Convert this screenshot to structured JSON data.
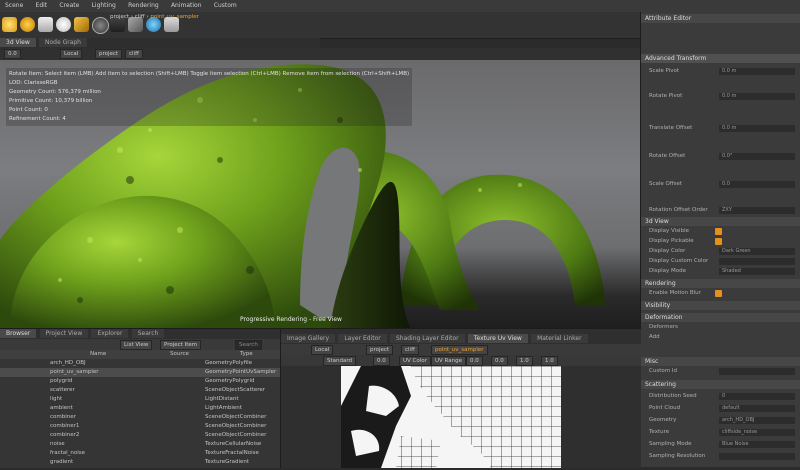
{
  "menubar": {
    "items": [
      "Scene",
      "Edit",
      "Create",
      "Lighting",
      "Rendering",
      "Animation",
      "Custom"
    ]
  },
  "breadcrumb_top": {
    "project": "project",
    "sep": "›",
    "node1": "cliff",
    "node2": "point_uv_sampler"
  },
  "viewport_tabs": {
    "active": "3d View",
    "other": "Node Graph"
  },
  "viewport_toolbar": {
    "space": "Local",
    "project": "project",
    "cliff": "cliff",
    "zoom": "0.0"
  },
  "viewport_info": {
    "hint": "Rotate Item: Select item (LMB)  Add item to selection (Shift+LMB)  Toggle item selection (Ctrl+LMB)  Remove item from selection (Ctrl+Shift+LMB)",
    "lines": [
      "LOD: ClarisseRGB",
      "Geometry Count: 576,379 million",
      "Primitive Count: 10,379 billion",
      "Point Count: 0",
      "Refinement Count: 4"
    ],
    "render_label": "Progressive Rendering - Free View"
  },
  "attribute_editor": {
    "title": "Attribute Editor",
    "section_transform": "Advanced Transform",
    "rows": [
      {
        "label": "Scale Pivot",
        "value": "0.0 m"
      },
      {
        "label": "Rotate Pivot",
        "value": "0.0 m"
      },
      {
        "label": "Translate Offset",
        "value": "0.0 m"
      },
      {
        "label": "Rotate Offset",
        "value": "0.0°"
      },
      {
        "label": "Scale Offset",
        "value": "0.0"
      },
      {
        "label": "Rotation Offset Order",
        "value": "ZXY"
      }
    ],
    "section_3d": "3d View",
    "rows_3d": [
      {
        "label": "Display Visible",
        "value": ""
      },
      {
        "label": "Display Pickable",
        "value": ""
      },
      {
        "label": "Display Color",
        "value": "Dark Green"
      },
      {
        "label": "Display Custom Color",
        "value": ""
      },
      {
        "label": "Display Mode",
        "value": "Shaded"
      }
    ],
    "section_rendering": "Rendering",
    "row_motion_blur": "Enable Motion Blur",
    "section_visibility": "Visibility",
    "section_deformation": "Deformation",
    "deformation_rows": [
      "Deformers",
      "Add"
    ],
    "section_misc": "Misc",
    "custom_id": "Custom Id",
    "section_scattering": "Scattering",
    "scatter_rows": [
      {
        "label": "Distribution Seed",
        "value": "0"
      },
      {
        "label": "Point Cloud",
        "value": "default"
      },
      {
        "label": "Geometry",
        "value": "arch_HD_OBJ"
      },
      {
        "label": "Texture",
        "value": "cliffside_noise"
      },
      {
        "label": "Sampling Mode",
        "value": "Blue Noise"
      },
      {
        "label": "Sampling Resolution",
        "value": ""
      }
    ]
  },
  "outliner": {
    "tabs": [
      "Browser",
      "Project View",
      "Explorer",
      "Search"
    ],
    "toolbar": {
      "view": "List View",
      "filter": "Project Item",
      "search": "Search"
    },
    "columns": {
      "name": "Name",
      "source": "Source",
      "type": "Type"
    },
    "rows": [
      {
        "name": "arch_HD_OBJ",
        "type": "GeometryPolyfile"
      },
      {
        "name": "point_uv_sampler",
        "type": "GeometryPointUvSampler"
      },
      {
        "name": "polygrid",
        "type": "GeometryPolygrid"
      },
      {
        "name": "scatterer",
        "type": "SceneObjectScatterer"
      },
      {
        "name": "light",
        "type": "LightDistant"
      },
      {
        "name": "ambient",
        "type": "LightAmbient"
      },
      {
        "name": "combiner",
        "type": "SceneObjectCombiner"
      },
      {
        "name": "combiner1",
        "type": "SceneObjectCombiner"
      },
      {
        "name": "combiner2",
        "type": "SceneObjectCombiner"
      },
      {
        "name": "noise",
        "type": "TextureCellularNoise"
      },
      {
        "name": "fractal_noise",
        "type": "TextureFractalNoise"
      },
      {
        "name": "gradient",
        "type": "TextureGradient"
      }
    ]
  },
  "uv_panel": {
    "tabs": [
      "Image Gallery",
      "Layer Editor",
      "Shading Layer Editor",
      "Texture Uv View",
      "Material Linker"
    ],
    "active_tab": "Texture Uv View",
    "toolbar": {
      "space": "Local",
      "project": "project",
      "cliff": "cliff",
      "node": "point_uv_sampler"
    },
    "toolbar2": {
      "mode": "Standard",
      "value": "0.0",
      "uv_color": "UV Color",
      "uv_range": "UV Range",
      "r0": "0.0",
      "r1": "0.0",
      "r2": "1.0",
      "r3": "1.0"
    }
  },
  "colors": {
    "accent": "#e6901e",
    "moss": "#7fb82a",
    "panel": "#3b3b3b"
  }
}
